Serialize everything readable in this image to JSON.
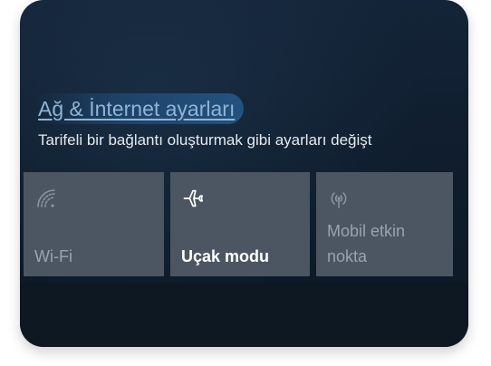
{
  "network": {
    "settings_link": "Ağ & İnternet ayarları",
    "description": "Tarifeli bir bağlantı oluşturmak gibi ayarları değişt"
  },
  "quick_actions": {
    "tiles": [
      {
        "label": "Wi-Fi",
        "icon": "wifi-icon",
        "state": "off"
      },
      {
        "label": "Uçak modu",
        "icon": "airplane-icon",
        "state": "on"
      },
      {
        "label": "Mobil etkin nokta",
        "icon": "mobile-hotspot-icon",
        "state": "off"
      }
    ]
  },
  "colors": {
    "background": "#0f1d2d",
    "link": "#8fb4d6",
    "tile": "#4c5662",
    "tile_text_inactive": "#9aa3ad",
    "tile_text_active": "#ffffff"
  }
}
